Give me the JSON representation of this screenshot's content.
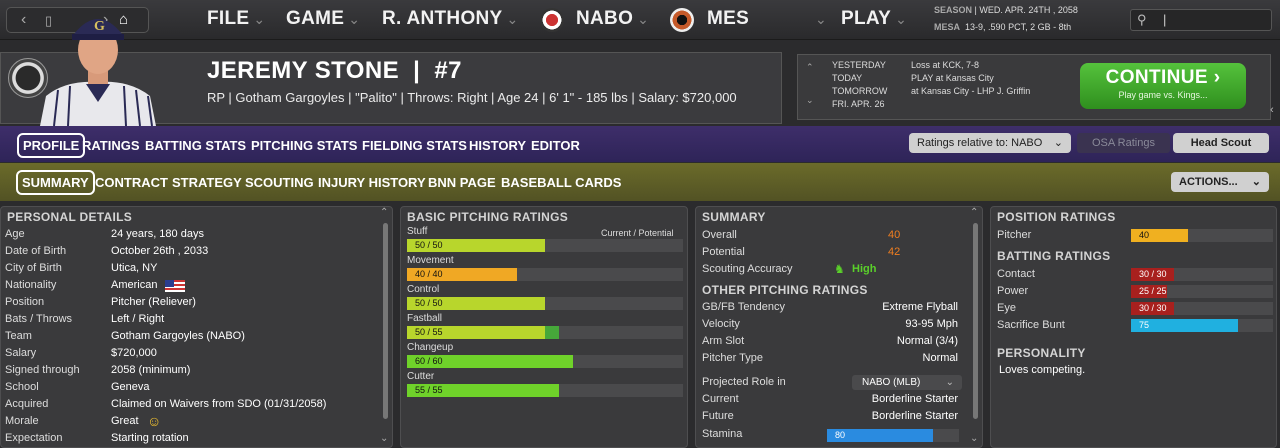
{
  "nav": {
    "menus": [
      "FILE",
      "GAME",
      "R. ANTHONY",
      "NABO",
      "MES",
      "PLAY"
    ],
    "season_label": "SEASON",
    "season_value": "WED. APR. 24TH , 2058",
    "team_label": "MESA",
    "team_value": "13-9, .590 PCT, 2 GB - 8th"
  },
  "player": {
    "name": "JEREMY STONE",
    "number": "#7",
    "info": "RP | Gotham Gargoyles  |  \"Palito\" | Throws: Right  |  Age 24  |  6' 1\" - 185 lbs  |  Salary: $720,000"
  },
  "schedule": {
    "rows": [
      {
        "label": "YESTERDAY",
        "value": "Loss at KCK, 7-8"
      },
      {
        "label": "TODAY",
        "value": "PLAY at Kansas City"
      },
      {
        "label": "TOMORROW",
        "value": "at Kansas City - LHP J. Griffin"
      },
      {
        "label": "FRI. APR. 26",
        "value": ""
      }
    ],
    "continue_label": "CONTINUE",
    "continue_sub": "Play game vs. Kings..."
  },
  "tabs1": [
    "PROFILE",
    "RATINGS",
    "BATTING STATS",
    "PITCHING STATS",
    "FIELDING STATS",
    "HISTORY",
    "EDITOR"
  ],
  "ratings_relative": "Ratings relative to: NABO",
  "osa_ratings": "OSA Ratings",
  "head_scout": "Head Scout",
  "tabs2": [
    "SUMMARY",
    "CONTRACT",
    "STRATEGY",
    "SCOUTING",
    "INJURY HISTORY",
    "BNN PAGE",
    "BASEBALL CARDS"
  ],
  "actions": "ACTIONS...",
  "personal": {
    "title": "PERSONAL DETAILS",
    "rows": [
      {
        "label": "Age",
        "value": "24 years, 180 days"
      },
      {
        "label": "Date of Birth",
        "value": "October 26th , 2033"
      },
      {
        "label": "City of Birth",
        "value": "Utica, NY"
      },
      {
        "label": "Nationality",
        "value": "American"
      },
      {
        "label": "Position",
        "value": "Pitcher (Reliever)"
      },
      {
        "label": "Bats / Throws",
        "value": "Left / Right"
      },
      {
        "label": "Team",
        "value": "Gotham Gargoyles (NABO)"
      },
      {
        "label": "Salary",
        "value": "$720,000"
      },
      {
        "label": "Signed through",
        "value": "2058 (minimum)"
      },
      {
        "label": "School",
        "value": "Geneva"
      },
      {
        "label": "Acquired",
        "value": "Claimed on Waivers from SDO (01/31/2058)"
      },
      {
        "label": "Morale",
        "value": "Great"
      },
      {
        "label": "Expectation",
        "value": "Starting rotation"
      }
    ]
  },
  "pitching": {
    "title": "BASIC PITCHING RATINGS",
    "header": "Current / Potential",
    "rows": [
      {
        "label": "Stuff",
        "text": "50 / 50",
        "current": 50,
        "potential": 50,
        "color": "#b8d62c"
      },
      {
        "label": "Movement",
        "text": "40 / 40",
        "current": 40,
        "potential": 40,
        "color": "#f0a824"
      },
      {
        "label": "Control",
        "text": "50 / 50",
        "current": 50,
        "potential": 50,
        "color": "#b8d62c"
      },
      {
        "label": "Fastball",
        "text": "50 / 55",
        "current": 50,
        "potential": 55,
        "color": "#b8d62c"
      },
      {
        "label": "Changeup",
        "text": "60 / 60",
        "current": 60,
        "potential": 60,
        "color": "#6fd22a"
      },
      {
        "label": "Cutter",
        "text": "55 / 55",
        "current": 55,
        "potential": 55,
        "color": "#6fd22a"
      }
    ]
  },
  "summary": {
    "title": "SUMMARY",
    "overall_label": "Overall",
    "overall_value": "40",
    "potential_label": "Potential",
    "potential_value": "42",
    "scouting_label": "Scouting Accuracy",
    "scouting_value": "High",
    "other_title": "OTHER PITCHING RATINGS",
    "other_rows": [
      {
        "label": "GB/FB Tendency",
        "value": "Extreme Flyball"
      },
      {
        "label": "Velocity",
        "value": "93-95 Mph"
      },
      {
        "label": "Arm Slot",
        "value": "Normal (3/4)"
      },
      {
        "label": "Pitcher Type",
        "value": "Normal"
      }
    ],
    "role_label": "Projected Role in",
    "role_value": "NABO (MLB)",
    "role_rows": [
      {
        "label": "Current",
        "value": "Borderline Starter"
      },
      {
        "label": "Future",
        "value": "Borderline Starter"
      }
    ],
    "stamina_label": "Stamina",
    "stamina_value": 80
  },
  "position": {
    "title": "POSITION RATINGS",
    "rows": [
      {
        "label": "Pitcher",
        "text": "40",
        "value": 40,
        "color": "#f0b020"
      }
    ],
    "batting_title": "BATTING RATINGS",
    "batting_rows": [
      {
        "label": "Contact",
        "text": "30 / 30",
        "value": 30,
        "color": "#a8201e"
      },
      {
        "label": "Power",
        "text": "25 / 25",
        "value": 25,
        "color": "#a8201e"
      },
      {
        "label": "Eye",
        "text": "30 / 30",
        "value": 30,
        "color": "#a8201e"
      },
      {
        "label": "Sacrifice Bunt",
        "text": "75",
        "value": 75,
        "color": "#20b0e0"
      }
    ],
    "personality_title": "PERSONALITY",
    "personality_text": "Loves competing."
  }
}
